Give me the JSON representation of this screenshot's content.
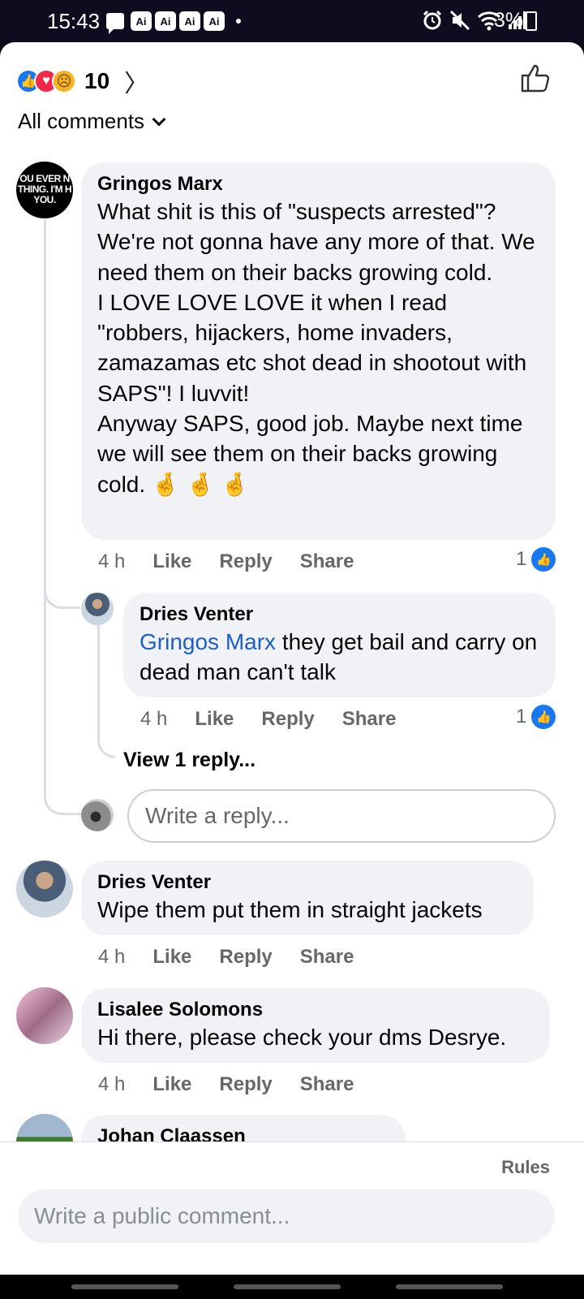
{
  "status_bar": {
    "time": "15:43",
    "ai_badges": [
      "Ai",
      "Ai",
      "Ai",
      "Ai"
    ],
    "battery": "3%",
    "icons": [
      "chat-icon",
      "alarm-icon",
      "mute-icon",
      "wifi-icon",
      "signal-icon",
      "battery-icon"
    ]
  },
  "header": {
    "reactions": [
      "like",
      "love",
      "sad"
    ],
    "reaction_count": "10",
    "sort_label": "All comments"
  },
  "comments": [
    {
      "name": "Gringos Marx",
      "avatar_text": "OU EVER N\nTHING. I'M H\nYOU.",
      "text": "What shit is this of \"suspects arrested\"? We're not gonna have any more of that. We need them on their backs growing cold.\n I LOVE LOVE LOVE it when I read \"robbers, hijackers, home invaders, zamazamas etc shot dead in shootout with SAPS\"! I luvvit!\nAnyway SAPS, good job. Maybe next time we will see them on their backs growing cold. 🤞 🤞 🤞",
      "time": "4 h",
      "like": "Like",
      "reply": "Reply",
      "share": "Share",
      "likes": "1"
    },
    {
      "name": "Dries Venter",
      "mention": "Gringos Marx",
      "text": " they get bail and carry on dead man can't talk",
      "time": "4 h",
      "like": "Like",
      "reply": "Reply",
      "share": "Share",
      "likes": "1"
    },
    {
      "name": "Dries Venter",
      "text": "Wipe them put them in straight jackets",
      "time": "4 h",
      "like": "Like",
      "reply": "Reply",
      "share": "Share"
    },
    {
      "name": "Lisalee Solomons",
      "text": "Hi there, please check your dms Desrye.",
      "time": "4 h",
      "like": "Like",
      "reply": "Reply",
      "share": "Share"
    },
    {
      "name": "Johan Claassen"
    }
  ],
  "view_replies": "View 1 reply...",
  "reply_placeholder": "Write a reply...",
  "rules": "Rules",
  "public_comment_placeholder": "Write a public comment..."
}
